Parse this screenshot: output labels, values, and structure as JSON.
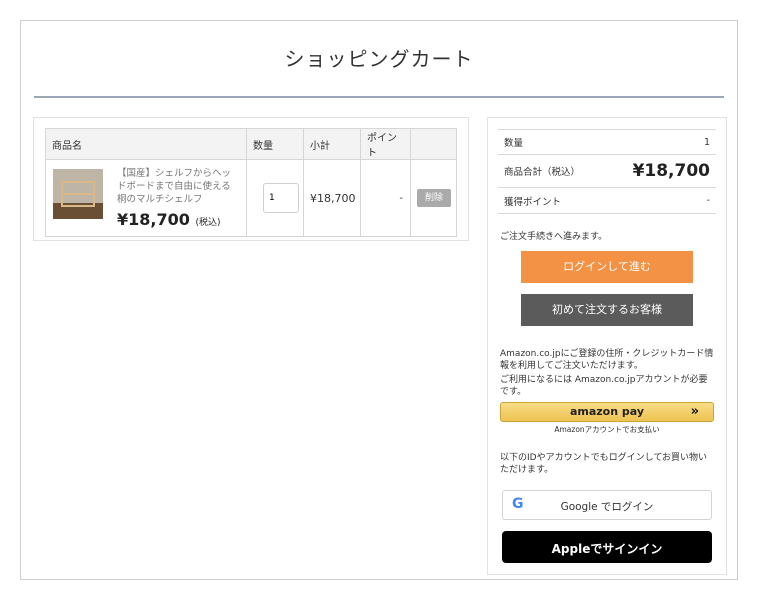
{
  "page": {
    "title": "ショッピングカート"
  },
  "cart": {
    "headers": {
      "name": "商品名",
      "qty": "数量",
      "subtotal": "小計",
      "points": "ポイント"
    },
    "item": {
      "name": "【国産】シェルフからヘッドボードまで自由に使える　桐のマルチシェルフ",
      "price": "¥18,700",
      "tax": "(税込)",
      "quantity": "1",
      "subtotal": "¥18,700",
      "points": "-",
      "delete_label": "削除"
    }
  },
  "summary": {
    "qty_label": "数量",
    "qty_value": "1",
    "total_label": "商品合計（税込）",
    "total_value": "¥18,700",
    "points_label": "獲得ポイント",
    "points_value": "-"
  },
  "checkout": {
    "proceed_note": "ご注文手続きへ進みます。",
    "login_button": "ログインして進む",
    "first_button": "初めて注文するお客様"
  },
  "amazon": {
    "note1": "Amazon.co.jpにご登録の住所・クレジットカード情報を利用してご注文いただけます。",
    "note2": "ご利用になるには Amazon.co.jpアカウントが必要です。",
    "button_label": "amazon pay",
    "button_arrows": "»",
    "sub": "Amazonアカウントでお支払い"
  },
  "social": {
    "note": "以下のIDやアカウントでもログインしてお買い物いただけます。",
    "google_icon": "G",
    "google_label": "Google でログイン",
    "apple_label": " Appleでサインイン"
  },
  "colors": {
    "login": "#f39145",
    "first": "#5b5b5b",
    "apple": "#000000",
    "amazon": "#eec350"
  }
}
